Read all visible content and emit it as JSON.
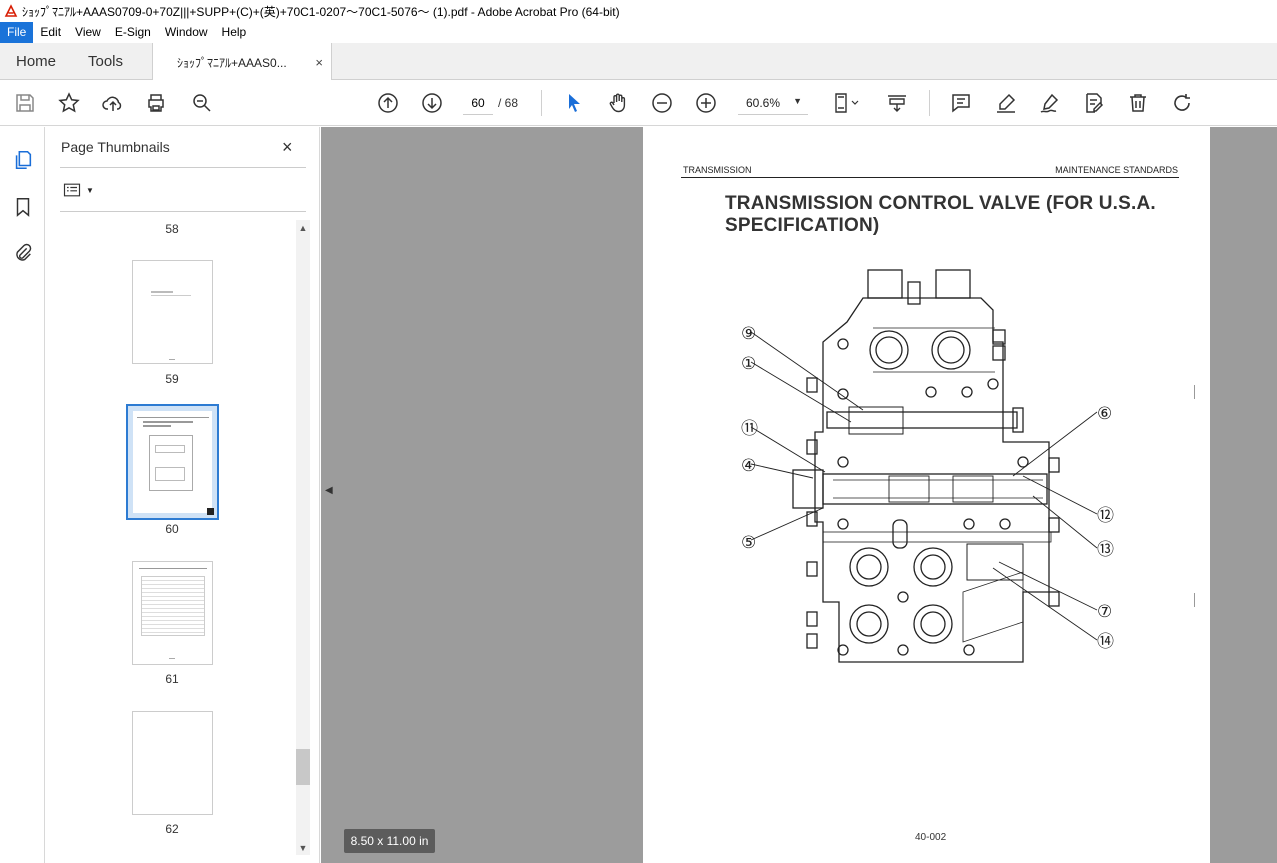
{
  "window": {
    "title": "ｼｮｯﾌﾟﾏﾆｱﾙ+AAAS0709-0+70Z|||+SUPP+(C)+(英)+70C1-0207～70C1-5076～ (1).pdf - Adobe Acrobat Pro (64-bit)"
  },
  "menu": [
    "File",
    "Edit",
    "View",
    "E-Sign",
    "Window",
    "Help"
  ],
  "tabs": {
    "home": "Home",
    "tools": "Tools",
    "doc": "ｼｮｯﾌﾟﾏﾆｱﾙ+AAAS0...",
    "doc_close": "×"
  },
  "toolbar": {
    "page_current": "60",
    "page_total": "/ 68",
    "zoom": "60.6%"
  },
  "panel": {
    "title": "Page Thumbnails",
    "close": "×",
    "thumbs": [
      {
        "label": "58"
      },
      {
        "label": "59"
      },
      {
        "label": "60",
        "selected": true
      },
      {
        "label": "61"
      },
      {
        "label": "62"
      }
    ]
  },
  "document": {
    "header_left": "TRANSMISSION",
    "header_right": "MAINTENANCE STANDARDS",
    "title": "TRANSMISSION CONTROL VALVE (FOR U.S.A. SPECIFICATION)",
    "footer": "40-002",
    "callouts": [
      "⑨",
      "①",
      "⑪",
      "④",
      "⑤",
      "⑥",
      "⑫",
      "⑬",
      "⑦",
      "⑭"
    ]
  },
  "status": {
    "page_size": "8.50 x 11.00 in"
  },
  "colors": {
    "accent": "#1a73d9",
    "selection": "#2d7bd2",
    "viewer_bg": "#9c9c9c"
  }
}
